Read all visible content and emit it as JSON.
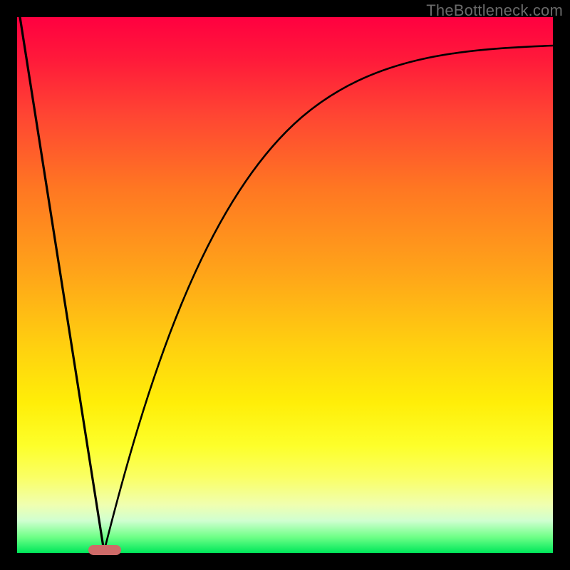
{
  "watermark": "TheBottleneck.com",
  "colors": {
    "frame": "#000000",
    "curve": "#000000",
    "marker": "#ce6a68",
    "gradient_top": "#ff0040",
    "gradient_bottom": "#00e85a"
  },
  "chart_data": {
    "type": "line",
    "title": "",
    "xlabel": "",
    "ylabel": "",
    "xlim": [
      0,
      100
    ],
    "ylim": [
      0,
      100
    ],
    "grid": false,
    "legend": false,
    "series": [
      {
        "name": "left-falling-line",
        "x": [
          0,
          16
        ],
        "y": [
          100,
          0
        ]
      },
      {
        "name": "right-rising-curve",
        "x": [
          16,
          20,
          25,
          30,
          35,
          40,
          45,
          50,
          55,
          60,
          65,
          70,
          75,
          80,
          85,
          90,
          95,
          100
        ],
        "y": [
          0,
          15,
          32,
          46,
          57,
          66,
          73,
          78,
          82,
          85,
          87.5,
          89.4,
          90.8,
          92,
          93,
          93.7,
          94.3,
          94.7
        ]
      }
    ],
    "marker": {
      "x_center": 16,
      "width_pct": 6,
      "y": 0
    },
    "background": "vertical red→yellow→green gradient (bottleneck heat scale)"
  }
}
